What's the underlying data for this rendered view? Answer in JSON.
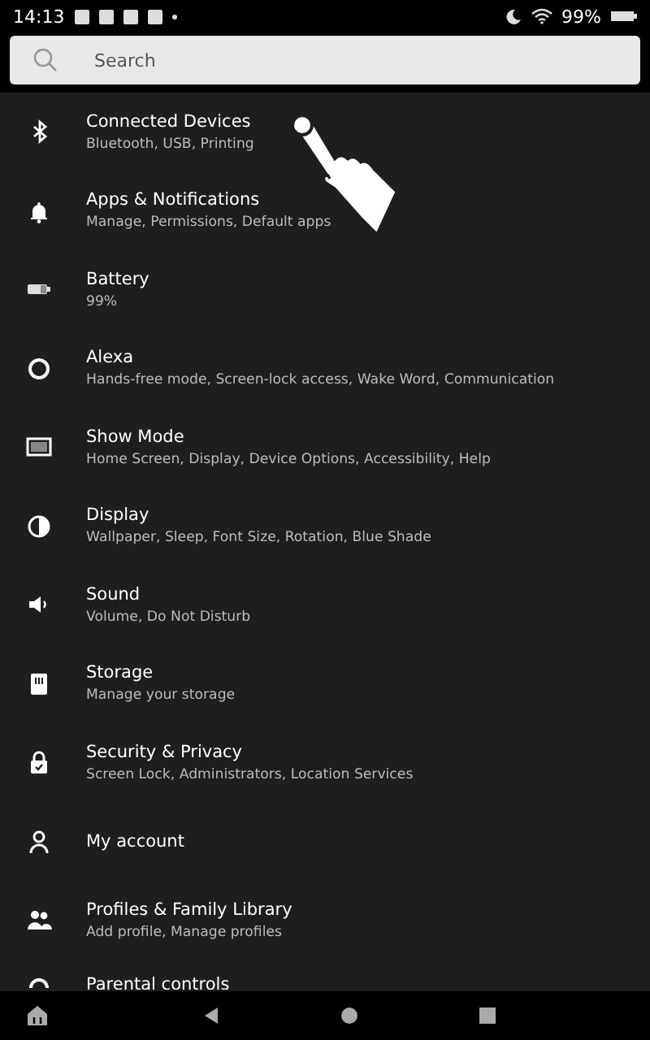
{
  "status_bar": {
    "time": "14:13",
    "battery": "99%"
  },
  "search": {
    "placeholder": "Search"
  },
  "settings": [
    {
      "kind": "bluetooth",
      "title": "Connected Devices",
      "subtitle": "Bluetooth, USB, Printing"
    },
    {
      "kind": "bell",
      "title": "Apps & Notifications",
      "subtitle": "Manage, Permissions, Default apps"
    },
    {
      "kind": "battery",
      "title": "Battery",
      "subtitle": "99%"
    },
    {
      "kind": "ring",
      "title": "Alexa",
      "subtitle": "Hands-free mode, Screen-lock access, Wake Word, Communication"
    },
    {
      "kind": "monitor",
      "title": "Show Mode",
      "subtitle": "Home Screen, Display, Device Options, Accessibility, Help"
    },
    {
      "kind": "contrast",
      "title": "Display",
      "subtitle": "Wallpaper, Sleep, Font Size, Rotation, Blue Shade"
    },
    {
      "kind": "speaker",
      "title": "Sound",
      "subtitle": "Volume, Do Not Disturb"
    },
    {
      "kind": "storage",
      "title": "Storage",
      "subtitle": "Manage your storage"
    },
    {
      "kind": "lock",
      "title": "Security & Privacy",
      "subtitle": "Screen Lock, Administrators, Location Services"
    },
    {
      "kind": "person",
      "title": "My account"
    },
    {
      "kind": "people",
      "title": "Profiles & Family Library",
      "subtitle": "Add profile, Manage profiles"
    },
    {
      "kind": "parental",
      "title": "Parental controls"
    }
  ]
}
